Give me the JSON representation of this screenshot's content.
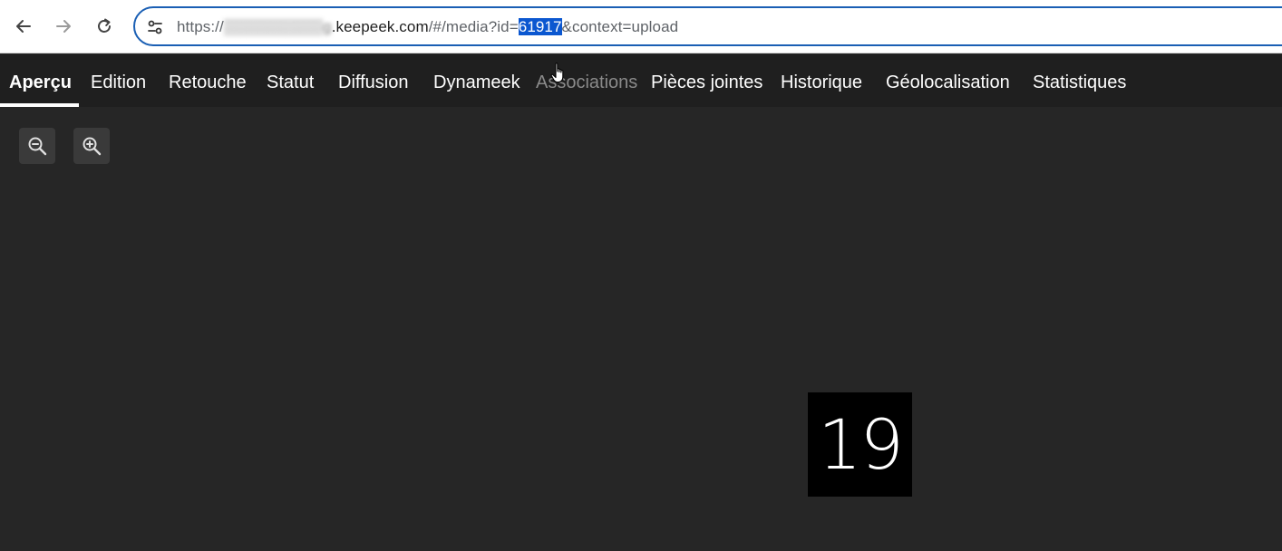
{
  "browser": {
    "url": {
      "scheme": "https://",
      "subdomain_blurred": "▒▒▒▒▒▒▒▒▒g",
      "domain": ".keepeek.com",
      "path": "/#/media?id=",
      "selected": "61917",
      "rest": "&context=upload"
    },
    "icons": {
      "back": "back-arrow-icon",
      "forward": "forward-arrow-icon",
      "reload": "reload-icon",
      "site_info": "tune-icon"
    }
  },
  "tabs": [
    {
      "label": "Aperçu",
      "state": "active"
    },
    {
      "label": "Edition",
      "state": "normal"
    },
    {
      "label": "Retouche",
      "state": "normal"
    },
    {
      "label": "Statut",
      "state": "normal"
    },
    {
      "label": "Diffusion",
      "state": "normal"
    },
    {
      "label": "Dynameek",
      "state": "normal"
    },
    {
      "label": "Associations",
      "state": "disabled"
    },
    {
      "label": "Pièces jointes",
      "state": "normal"
    },
    {
      "label": "Historique",
      "state": "normal"
    },
    {
      "label": "Géolocalisation",
      "state": "normal"
    },
    {
      "label": "Statistiques",
      "state": "normal"
    }
  ],
  "viewer": {
    "zoom_out_icon": "zoom-out-icon",
    "zoom_in_icon": "zoom-in-icon",
    "preview_text": "19"
  },
  "colors": {
    "omnibox_border": "#1a5fb4",
    "selection": "#0b57d0",
    "tabbar_bg": "#1f1f1f",
    "viewer_bg": "#262626"
  }
}
